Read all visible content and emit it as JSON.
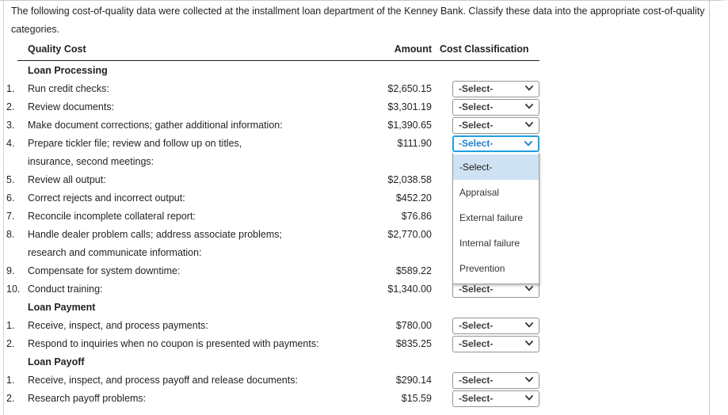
{
  "intro": "The following cost-of-quality data were collected at the installment loan department of the Kenney Bank. Classify these data into the appropriate cost-of-quality categories.",
  "table": {
    "headers": {
      "quality_cost": "Quality Cost",
      "amount": "Amount",
      "cost_classification": "Cost Classification"
    },
    "rows": [
      {
        "type": "group",
        "num": "",
        "desc": "Loan Processing",
        "amount": "",
        "select": null
      },
      {
        "type": "item",
        "num": "1.",
        "desc": "Run credit checks:",
        "amount": "$2,650.15",
        "select": "-Select-"
      },
      {
        "type": "item",
        "num": "2.",
        "desc": "Review documents:",
        "amount": "$3,301.19",
        "select": "-Select-"
      },
      {
        "type": "item",
        "num": "3.",
        "desc": "Make document corrections; gather additional information:",
        "amount": "$1,390.65",
        "select": "-Select-"
      },
      {
        "type": "item",
        "num": "4.",
        "desc": "Prepare tickler file; review and follow up on titles,",
        "amount": "$111.90",
        "select": "-Select-",
        "focused": true
      },
      {
        "type": "cont",
        "num": "",
        "desc": "insurance, second meetings:",
        "amount": "",
        "select": null
      },
      {
        "type": "item",
        "num": "5.",
        "desc": "Review all output:",
        "amount": "$2,038.58",
        "select": "-Select-",
        "hidden_select": true
      },
      {
        "type": "item",
        "num": "6.",
        "desc": "Correct rejects and incorrect output:",
        "amount": "$452.20",
        "select": "-Select-",
        "hidden_select": true
      },
      {
        "type": "item",
        "num": "7.",
        "desc": "Reconcile incomplete collateral report:",
        "amount": "$76.86",
        "select": "-Select-",
        "hidden_select": true
      },
      {
        "type": "item",
        "num": "8.",
        "desc": "Handle dealer problem calls; address associate problems;",
        "amount": "$2,770.00",
        "select": "-Select-",
        "hidden_select": true
      },
      {
        "type": "cont",
        "num": "",
        "desc": "research and communicate information:",
        "amount": "",
        "select": null
      },
      {
        "type": "item",
        "num": "9.",
        "desc": "Compensate for system downtime:",
        "amount": "$589.22",
        "select": "-Select-",
        "hidden_select": true
      },
      {
        "type": "item",
        "num": "10.",
        "desc": "Conduct training:",
        "amount": "$1,340.00",
        "select": "-Select-"
      },
      {
        "type": "group",
        "num": "",
        "desc": "Loan Payment",
        "amount": "",
        "select": null
      },
      {
        "type": "item",
        "num": "1.",
        "desc": "Receive, inspect, and process payments:",
        "amount": "$780.00",
        "select": "-Select-"
      },
      {
        "type": "item",
        "num": "2.",
        "desc": "Respond to inquiries when no coupon is presented with payments:",
        "amount": "$835.25",
        "select": "-Select-"
      },
      {
        "type": "group",
        "num": "",
        "desc": "Loan Payoff",
        "amount": "",
        "select": null
      },
      {
        "type": "item",
        "num": "1.",
        "desc": "Receive, inspect, and process payoff and release documents:",
        "amount": "$290.14",
        "select": "-Select-"
      },
      {
        "type": "item",
        "num": "2.",
        "desc": "Research payoff problems:",
        "amount": "$15.59",
        "select": "-Select-"
      }
    ]
  },
  "dropdown": {
    "open": true,
    "open_on_row_index": 4,
    "selected_value": "-Select-",
    "options": [
      "-Select-",
      "Appraisal",
      "External failure",
      "Internal failure",
      "Prevention"
    ],
    "highlighted_option": "-Select-"
  },
  "colors": {
    "focus_border": "#1f9fe0",
    "focus_text": "#1f7fd0",
    "highlight_bg": "#cfe2f3",
    "text": "#231f20",
    "select_border": "#949494"
  }
}
